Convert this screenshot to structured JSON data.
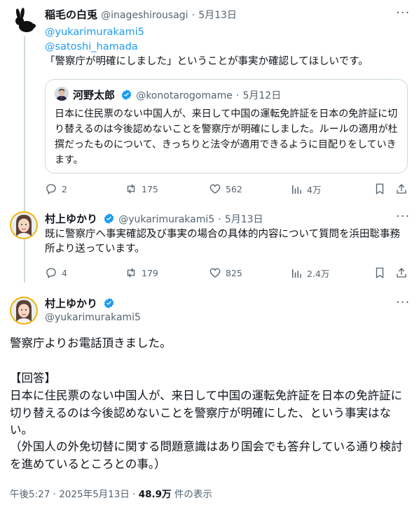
{
  "tweet1": {
    "author_name": "稲毛の白兎",
    "author_handle": "@inageshirousagi",
    "date": "5月13日",
    "mention1": "@yukarimurakami5",
    "mention2": "@satoshi_hamada",
    "text": "「警察庁が明確にしました」ということが事実か確認してほしいです。",
    "quote": {
      "author_name": "河野太郎",
      "author_handle": "@konotarogomame",
      "date": "5月12日",
      "text": "日本に住民票のない中国人が、来日して中国の運転免許証を日本の免許証に切り替えるのは今後認めないことを警察庁が明確にしました。ルールの適用が杜撰だったものについて、きっちりと法令が適用できるように目配りをしていきます。"
    },
    "replies": "2",
    "reposts": "175",
    "likes": "562",
    "views": "4万"
  },
  "tweet2": {
    "author_name": "村上ゆかり",
    "author_handle": "@yukarimurakami5",
    "date": "5月13日",
    "text": "既に警察庁へ事実確認及び事実の場合の具体的内容について質問を浜田聡事務所より送っています。",
    "replies": "4",
    "reposts": "179",
    "likes": "825",
    "views": "2.4万"
  },
  "main": {
    "author_name": "村上ゆかり",
    "author_handle": "@yukarimurakami5",
    "line1": "警察庁よりお電話頂きました。",
    "heading": "【回答】",
    "body": "日本に住民票のない中国人が、来日して中国の運転免許証を日本の免許証に切り替えるのは今後認めないことを警察庁が明確にした、という事実はない。",
    "note": "（外国人の外免切替に関する問題意識はあり国会でも答弁している通り検討を進めているところとの事。）",
    "time": "午後5:27",
    "post_date": "2025年5月13日",
    "views_count": "48.9万",
    "views_label": "件の表示"
  },
  "colors": {
    "verified": "#1d9bf0",
    "link": "#1d9bf0",
    "muted": "#536471",
    "thread_line": "#cfd9de"
  }
}
